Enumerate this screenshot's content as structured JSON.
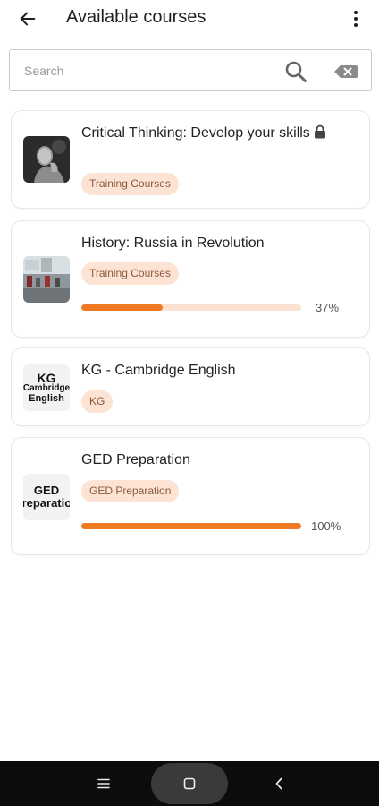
{
  "header": {
    "title": "Available courses"
  },
  "search": {
    "placeholder": "Search",
    "value": ""
  },
  "courses": [
    {
      "title": "Critical Thinking: Develop your skills",
      "tag": "Training Courses",
      "locked": true
    },
    {
      "title": "History: Russia in Revolution",
      "tag": "Training Courses",
      "progress": 0.37,
      "progress_label": "37%"
    },
    {
      "title": "KG - Cambridge English",
      "tag": "KG",
      "thumb_lines": [
        "KG",
        "Cambridge",
        "English"
      ]
    },
    {
      "title": "GED Preparation",
      "tag": "GED Preparation",
      "progress": 1.0,
      "progress_label": "100%",
      "thumb_lines": [
        "GED",
        "Preparation"
      ]
    }
  ],
  "colors": {
    "accent": "#ef7a24",
    "tag_bg": "#fde3d3",
    "tag_text": "#8a5a3d",
    "progress_track": "#fbe2d2"
  },
  "icons": {
    "back": "arrow-left-icon",
    "menu": "more-vertical-icon",
    "search": "search-icon",
    "clear": "backspace-icon",
    "lock": "lock-icon"
  }
}
